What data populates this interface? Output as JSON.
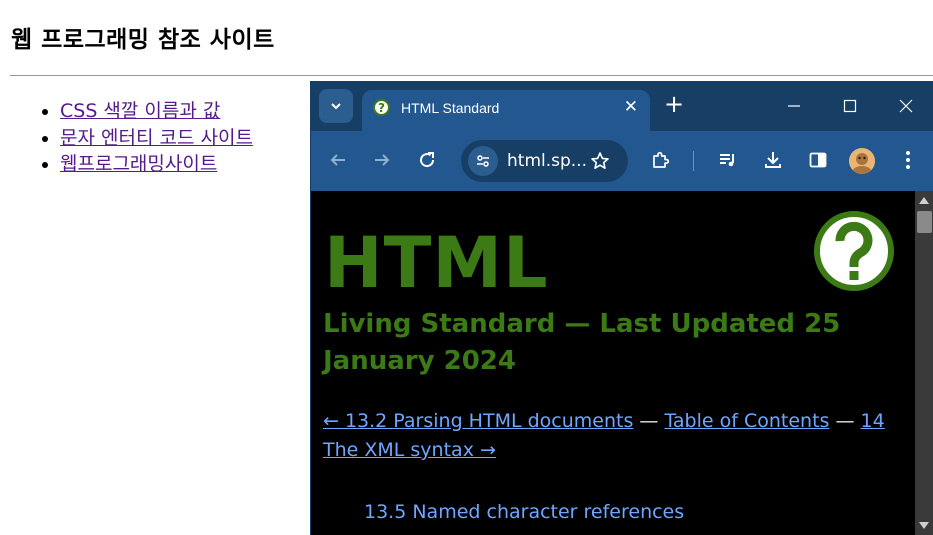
{
  "page": {
    "title": "웹 프로그래밍 참조 사이트",
    "links": [
      {
        "label": "CSS 색깔 이름과 값"
      },
      {
        "label": "문자 엔터티 코드 사이트"
      },
      {
        "label": "웹프로그래밍사이트"
      }
    ]
  },
  "browser": {
    "tab": {
      "title": "HTML Standard",
      "favicon": "question-mark-icon"
    },
    "url": "html.sp...",
    "content": {
      "heading": "HTML",
      "subtitle": "Living Standard — Last Updated 25 January 2024",
      "nav": {
        "prev": "← 13.2 Parsing HTML documents",
        "sep1": " — ",
        "toc": "Table of Contents",
        "sep2": " — ",
        "next": "14 The XML syntax →"
      },
      "section": "13.5 Named character references"
    },
    "icons": {
      "tab_search": "chevron-down-icon",
      "new_tab": "plus-icon",
      "minimize": "minimize-icon",
      "maximize": "maximize-icon",
      "close": "close-icon",
      "back": "arrow-left-icon",
      "forward": "arrow-right-icon",
      "reload": "reload-icon",
      "site_info": "tune-icon",
      "bookmark": "star-icon",
      "extensions": "puzzle-icon",
      "media": "media-control-icon",
      "downloads": "download-icon",
      "side_panel": "side-panel-icon",
      "profile": "avatar-icon",
      "menu": "kebab-menu-icon"
    },
    "colors": {
      "frame": "#173f66",
      "toolbar": "#22588f",
      "content_bg": "#000000",
      "heading_green": "#3c7a16",
      "link_blue": "#6fa6ff"
    }
  }
}
